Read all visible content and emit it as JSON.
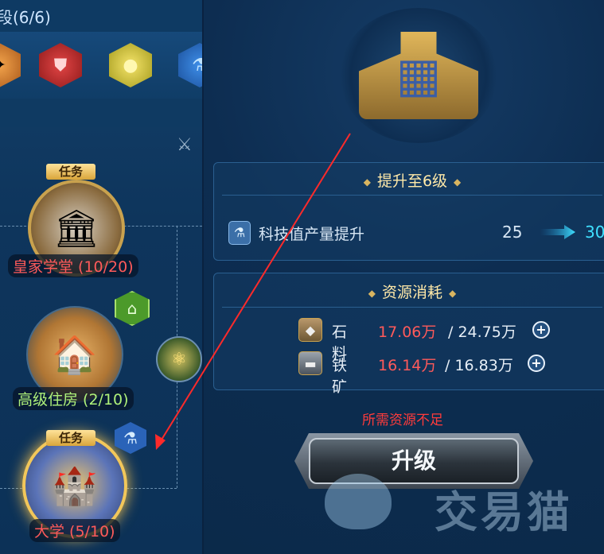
{
  "left_panel": {
    "title": "段(6/6)",
    "tech_icons": [
      "orange-hex-icon",
      "shield-icon",
      "coin-icon",
      "flask-icon"
    ],
    "buildings": [
      {
        "tag": "任务",
        "label": "皇家学堂 (10/20)",
        "label_color": "#ff5a5a"
      },
      {
        "label": "高级住房 (2/10)",
        "label_color": "#aef07a"
      },
      {
        "tag": "任务",
        "label": "大学 (5/10)",
        "label_color": "#ff5a5a",
        "selected": true
      }
    ]
  },
  "upgrade": {
    "title": "提升至6级",
    "stat": {
      "label": "科技值产量提升",
      "from": "25",
      "to": "30"
    }
  },
  "resources": {
    "title": "资源消耗",
    "items": [
      {
        "name": "石料",
        "required": "17.06万",
        "owned": "/ 24.75万",
        "icon": "stone-icon"
      },
      {
        "name": "铁矿",
        "required": "16.14万",
        "owned": "/ 16.83万",
        "icon": "iron-icon"
      }
    ],
    "warning": "所需资源不足"
  },
  "button": {
    "label": "升级"
  },
  "watermark": {
    "text": "交易猫"
  },
  "colors": {
    "insufficient": "#ff5a5a",
    "stat_to": "#3fe0ff",
    "title_gold": "#ffe9a8"
  }
}
